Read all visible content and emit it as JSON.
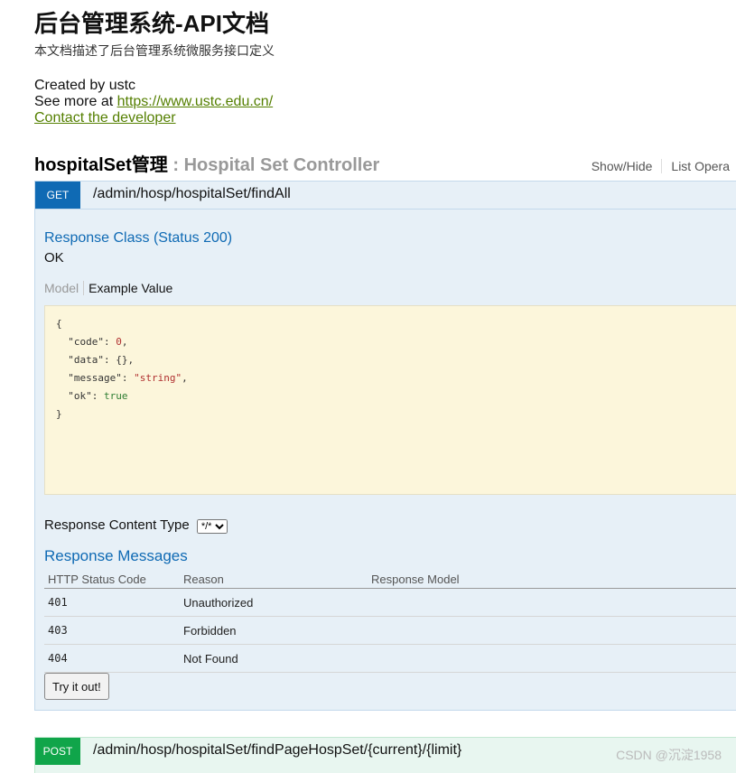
{
  "doc": {
    "title": "后台管理系统-API文档",
    "description": "本文档描述了后台管理系统微服务接口定义",
    "created_by": "Created by ustc",
    "see_more_prefix": "See more at ",
    "see_more_link": "https://www.ustc.edu.cn/",
    "contact": "Contact the developer"
  },
  "controller": {
    "name": "hospitalSet管理",
    "subtitle": " : Hospital Set Controller",
    "ops": [
      "Show/Hide",
      "List Opera"
    ]
  },
  "get_op": {
    "method": "GET",
    "path": "/admin/hosp/hospitalSet/findAll",
    "response_class": "Response Class (Status 200)",
    "response_status": "OK",
    "tab_model": "Model",
    "tab_example": "Example Value",
    "response_content_type_label": "Response Content Type",
    "response_content_type_value": "*/*",
    "response_messages_title": "Response Messages",
    "table_headers": [
      "HTTP Status Code",
      "Reason",
      "Response Model"
    ],
    "rows": [
      {
        "code": "401",
        "reason": "Unauthorized"
      },
      {
        "code": "403",
        "reason": "Forbidden"
      },
      {
        "code": "404",
        "reason": "Not Found"
      }
    ],
    "try_button": "Try it out!"
  },
  "example_json": {
    "open": "{",
    "code_key": "\"code\"",
    "code_val": "0",
    "data_key": "\"data\"",
    "data_val": "{}",
    "message_key": "\"message\"",
    "message_val": "\"string\"",
    "ok_key": "\"ok\"",
    "ok_val": "true",
    "close": "}"
  },
  "post_op": {
    "method": "POST",
    "path": "/admin/hosp/hospitalSet/findPageHospSet/{current}/{limit}"
  },
  "watermark": "CSDN @沉淀1958"
}
